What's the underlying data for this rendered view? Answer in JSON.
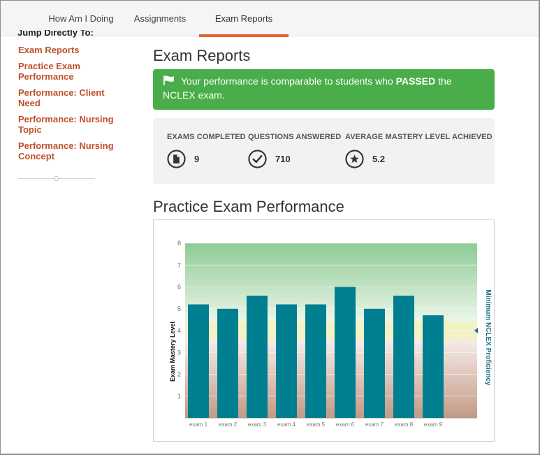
{
  "tabs": [
    {
      "label": "How Am I Doing"
    },
    {
      "label": "Assignments"
    },
    {
      "label": "Exam Reports"
    }
  ],
  "sidebar": {
    "heading": "Jump Directly To:",
    "links": [
      {
        "label": "Exam Reports"
      },
      {
        "label": "Practice Exam Performance"
      },
      {
        "label": "Performance: Client Need"
      },
      {
        "label": "Performance: Nursing Topic"
      },
      {
        "label": "Performance: Nursing Concept"
      }
    ]
  },
  "main": {
    "title": "Exam Reports",
    "alert": {
      "prefix": "Your performance is comparable to students who ",
      "emphasis": "PASSED",
      "suffix": " the NCLEX exam.",
      "color": "#49ae49"
    },
    "stats": [
      {
        "label": "EXAMS COMPLETED",
        "value": "9",
        "icon": "document-icon"
      },
      {
        "label": "QUESTIONS ANSWERED",
        "value": "710",
        "icon": "checkmark-circle-icon"
      },
      {
        "label": "AVERAGE MASTERY LEVEL ACHIEVED",
        "value": "5.2",
        "icon": "star-circle-icon"
      }
    ],
    "section_title": "Practice Exam Performance"
  },
  "chart_data": {
    "type": "bar",
    "categories": [
      "exam 1",
      "exam 2",
      "exam 3",
      "exam 4",
      "exam 5",
      "exam 6",
      "exam 7",
      "exam 8",
      "exam 9"
    ],
    "values": [
      5.2,
      5.0,
      5.6,
      5.2,
      5.2,
      6.0,
      5.0,
      5.6,
      4.7
    ],
    "ylabel": "Exam Mastery Level",
    "right_label": "Minimum NCLEX Proficiency",
    "ylim": [
      0,
      8
    ],
    "yticks": [
      "1",
      "2",
      "3",
      "4",
      "5",
      "6",
      "7",
      "8"
    ],
    "proficiency_band": [
      3.6,
      4.4
    ],
    "bar_color": "#007f91",
    "grid": true
  }
}
